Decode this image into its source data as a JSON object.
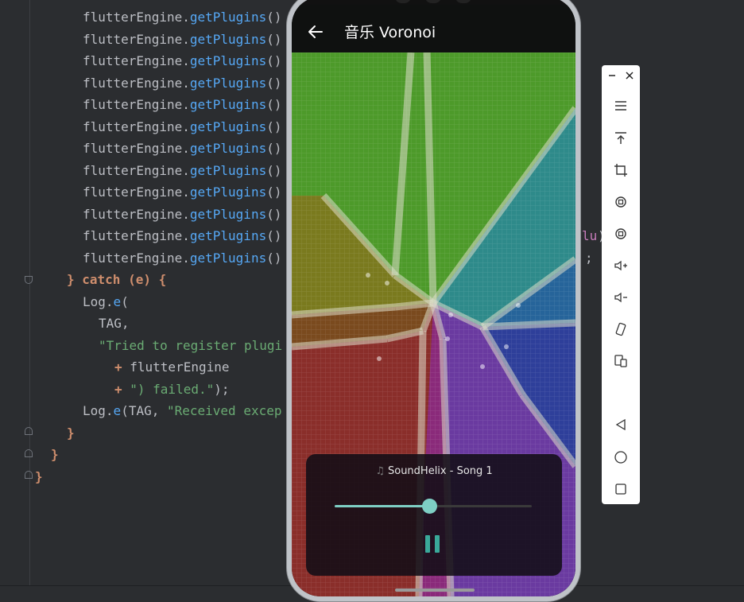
{
  "editor": {
    "lines": [
      {
        "indent": "      ",
        "obj": "flutterEngine",
        "method": "getPlugins",
        "tail": "()"
      },
      {
        "indent": "      ",
        "obj": "flutterEngine",
        "method": "getPlugins",
        "tail": "()"
      },
      {
        "indent": "      ",
        "obj": "flutterEngine",
        "method": "getPlugins",
        "tail": "()"
      },
      {
        "indent": "      ",
        "obj": "flutterEngine",
        "method": "getPlugins",
        "tail": "()"
      },
      {
        "indent": "      ",
        "obj": "flutterEngine",
        "method": "getPlugins",
        "tail": "()"
      },
      {
        "indent": "      ",
        "obj": "flutterEngine",
        "method": "getPlugins",
        "tail": "()"
      },
      {
        "indent": "      ",
        "obj": "flutterEngine",
        "method": "getPlugins",
        "tail": "()"
      },
      {
        "indent": "      ",
        "obj": "flutterEngine",
        "method": "getPlugins",
        "tail": "()"
      },
      {
        "indent": "      ",
        "obj": "flutterEngine",
        "method": "getPlugins",
        "tail": "()"
      },
      {
        "indent": "      ",
        "obj": "flutterEngine",
        "method": "getPlugins",
        "tail": "()"
      },
      {
        "indent": "      ",
        "obj": "flutterEngine",
        "method": "getPlugins",
        "tail": "()"
      },
      {
        "indent": "      ",
        "obj": "flutterEngine",
        "method": "getPlugins",
        "tail": "()"
      }
    ],
    "right_fragments": [
      "lu",
      "));",
      ";"
    ],
    "catch_line": {
      "brace": "} ",
      "kw": "catch",
      "rest": " (e) {"
    },
    "log_e_1": {
      "obj": "Log",
      "method": "e",
      "tail": "("
    },
    "tag_line": "TAG,",
    "str_tried": "\"Tried to register plugi",
    "plus_engine": {
      "op": "+ ",
      "val": "flutterEngine"
    },
    "plus_failed": {
      "op": "+ ",
      "str": "\") failed.\"",
      "tail": ");"
    },
    "log_e_2": {
      "obj": "Log",
      "method": "e",
      "args": "(TAG, ",
      "str": "\"Received excep"
    },
    "close1": "}",
    "close2": "}",
    "close3": "}"
  },
  "app": {
    "title": "音乐 Voronoi",
    "back_icon": "arrow-left-icon",
    "player": {
      "song_icon": "♫",
      "song_title": "SoundHelix - Song 1",
      "progress": 0.48,
      "accent_color": "#7ecfc4",
      "pause_color": "#3aa99a"
    },
    "voronoi_colors": {
      "green": "#4d9a2a",
      "olive": "#7a7a1e",
      "teal": "#2e8a8a",
      "blue": "#26649a",
      "navy": "#2e3f9a",
      "purple": "#6a3aa0",
      "magenta": "#8a2a7a",
      "red": "#8a2e2a",
      "brown": "#7a4a1e"
    }
  },
  "toolbar": {
    "items": [
      "minimize-icon",
      "close-icon",
      "menu-icon",
      "upload-icon",
      "crop-icon",
      "rotate-left-icon",
      "rotate-right-icon",
      "volume-up-icon",
      "volume-down-icon",
      "shake-icon",
      "device-swap-icon",
      "back-nav-icon",
      "home-nav-icon",
      "overview-nav-icon"
    ]
  }
}
